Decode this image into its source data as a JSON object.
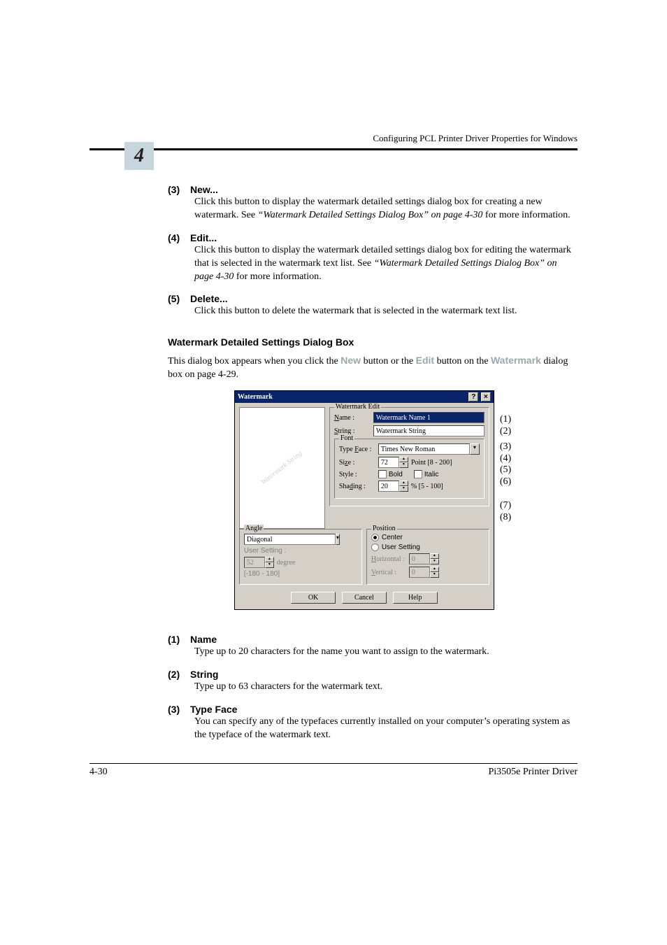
{
  "runheadTitle": "Configuring PCL Printer Driver Properties for Windows",
  "chapterNumber": "4",
  "items_top": [
    {
      "num": "(3)",
      "title": "New...",
      "body_a": "Click this button to display the watermark detailed settings dialog box for creating a new watermark. See ",
      "body_em": "“Watermark Detailed Settings Dialog Box” on page 4-30",
      "body_b": " for more information."
    },
    {
      "num": "(4)",
      "title": "Edit...",
      "body_a": "Click this button to display the watermark detailed settings dialog box for editing the watermark that is selected in the watermark text list. See ",
      "body_em": "“Watermark Detailed Settings Dialog Box” on page 4-30",
      "body_b": " for more information."
    },
    {
      "num": "(5)",
      "title": "Delete...",
      "body_a": "Click this button to delete the watermark that is selected in the watermark text list.",
      "body_em": "",
      "body_b": ""
    }
  ],
  "sectionHeading": "Watermark Detailed Settings Dialog Box",
  "introPara_a": "This dialog box appears when you click the ",
  "introPara_new": "New",
  "introPara_b": " button or the ",
  "introPara_edit": "Edit",
  "introPara_c": " button on the ",
  "introPara_wm": "Watermark",
  "introPara_d": " dialog box on page 4-29.",
  "dialog": {
    "title": "Watermark",
    "helpBtn": "?",
    "closeBtn": "×",
    "previewText": "Watermark String",
    "editGroup": "Watermark Edit",
    "nameLbl": "Name :",
    "nameVal": "Watermark Name 1",
    "stringLbl": "String :",
    "stringVal": "Watermark String",
    "fontGroup": "Font",
    "typefaceLbl": "Type Face :",
    "typefaceVal": "Times New Roman",
    "sizeLbl": "Size :",
    "sizeVal": "72",
    "sizeHint": "Point [8 - 200]",
    "styleLbl": "Style :",
    "boldLbl": "Bold",
    "italicLbl": "Italic",
    "shadingLbl": "Shading :",
    "shadingVal": "20",
    "shadingHint": "%   [5 - 100]",
    "angleGroup": "Angle",
    "angleVal": "Diagonal",
    "userSettingLbl": "User Setting :",
    "angleUserVal": "52",
    "angleUserHint": "degree",
    "angleRange": "[-180 - 180]",
    "posGroup": "Position",
    "centerLbl": "Center",
    "userSetRadioLbl": "User Setting",
    "horizLbl": "Horizontal :",
    "horizVal": "0",
    "vertLbl": "Vertical :",
    "vertVal": "0",
    "okBtn": "OK",
    "cancelBtn": "Cancel",
    "helpBtn2": "Help"
  },
  "callouts": [
    "(1)",
    "(2)",
    "(3)",
    "(4)",
    "(5)",
    "(6)",
    "(7)",
    "(8)"
  ],
  "items_bottom": [
    {
      "num": "(1)",
      "title": "Name",
      "body": "Type up to 20 characters for the name you want to assign to the watermark."
    },
    {
      "num": "(2)",
      "title": "String",
      "body": "Type up to 63 characters for the watermark text."
    },
    {
      "num": "(3)",
      "title": "Type Face",
      "body": "You can specify any of the typefaces currently installed on your computer’s operating system as the typeface of the watermark text."
    }
  ],
  "pageNum": "4-30",
  "driverName": "Pi3505e Printer Driver"
}
